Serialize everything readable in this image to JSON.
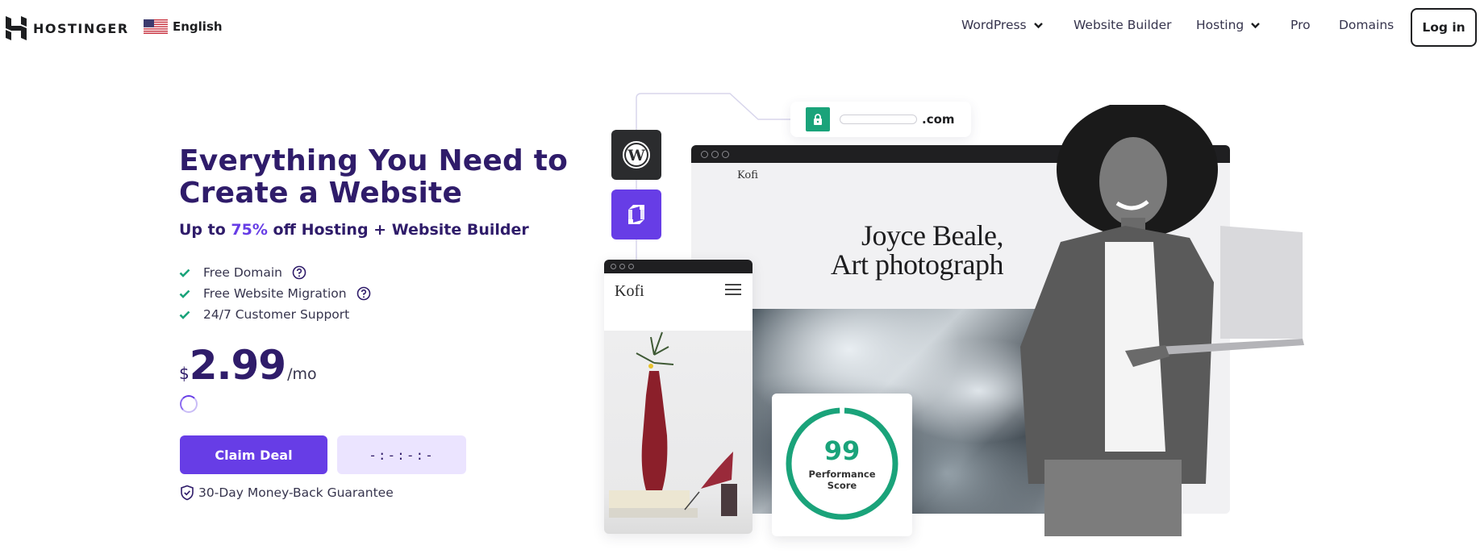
{
  "header": {
    "brand": "HOSTINGER",
    "language": {
      "label": "English",
      "flag": "us-flag-icon"
    },
    "nav": [
      {
        "label": "WordPress",
        "has_dropdown": true
      },
      {
        "label": "Website Builder",
        "has_dropdown": false
      },
      {
        "label": "Hosting",
        "has_dropdown": true
      },
      {
        "label": "Pro",
        "has_dropdown": false
      },
      {
        "label": "Domains",
        "has_dropdown": false
      }
    ],
    "login_label": "Log in"
  },
  "hero": {
    "title_line1": "Everything You Need to",
    "title_line2": "Create a Website",
    "subtitle_prefix": "Up to ",
    "subtitle_accent": "75%",
    "subtitle_suffix": " off Hosting + Website Builder",
    "features": [
      {
        "label": "Free Domain",
        "has_help": true
      },
      {
        "label": "Free Website Migration",
        "has_help": true
      },
      {
        "label": "24/7 Customer Support",
        "has_help": false
      }
    ],
    "price": {
      "currency": "$",
      "amount": "2.99",
      "period": "/mo"
    },
    "cta_label": "Claim Deal",
    "timer": "-:-:-:-",
    "guarantee": "30-Day Money-Back Guarantee"
  },
  "illustration": {
    "domain_suffix": ".com",
    "site_brand": "Kofi",
    "site_headline_line1": "Joyce Beale,",
    "site_headline_line2": "Art photograph",
    "mobile_brand": "Kofi",
    "performance": {
      "score": "99",
      "label_line1": "Performance",
      "label_line2": "Score",
      "fraction": 0.99
    }
  },
  "colors": {
    "primary": "#673de6",
    "heading": "#2f1c6a",
    "success": "#1aa37a",
    "timer_bg": "#ebe4ff"
  }
}
